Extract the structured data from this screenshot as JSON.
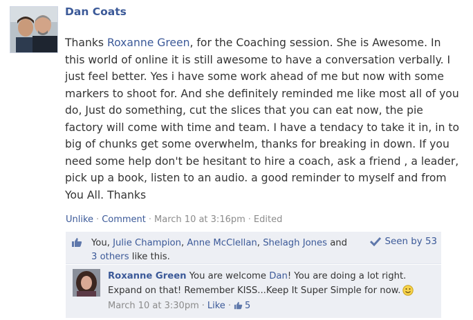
{
  "post": {
    "author": "Dan Coats",
    "text_before_link": "Thanks ",
    "mention": "Roxanne Green",
    "text_after_link": ", for the Coaching session. She is Awesome. In this world of online it is still awesome to have a conversation verbally. I just feel better. Yes i have some work ahead of me but now with some markers to shoot for. And she definitely reminded me like most all of you do, Just do something, cut the slices that you can eat now, the pie factory will come with time and team. I have a tendacy to take it in, in to big of chunks get some overwhelm, thanks for breaking in down. If you need some help don't be hesitant to hire a coach, ask a friend , a leader, pick up a book, listen to an audio. a good reminder to myself and from You All. Thanks",
    "actions": {
      "unlike": "Unlike",
      "comment": "Comment",
      "timestamp": "March 10 at 3:16pm",
      "edited": "Edited",
      "separator": "·"
    }
  },
  "likes": {
    "prefix": "You, ",
    "people": [
      "Julie Champion",
      "Anne McClellan",
      "Shelagh Jones"
    ],
    "comma": ", ",
    "and": " and ",
    "others_link": "3 others",
    "suffix": " like this.",
    "seen_by": "Seen by 53"
  },
  "comment": {
    "author": "Roxanne Green",
    "text_1": " You are welcome ",
    "mention": "Dan",
    "text_2": "! You are doing a lot right. Expand on that! Remember KISS...Keep It Super Simple for now.",
    "timestamp": "March 10 at 3:30pm",
    "like": "Like",
    "like_count": "5",
    "separator": "·"
  },
  "colors": {
    "link": "#3b5998",
    "meta": "#8b8b8b",
    "panel": "#edeff4"
  }
}
